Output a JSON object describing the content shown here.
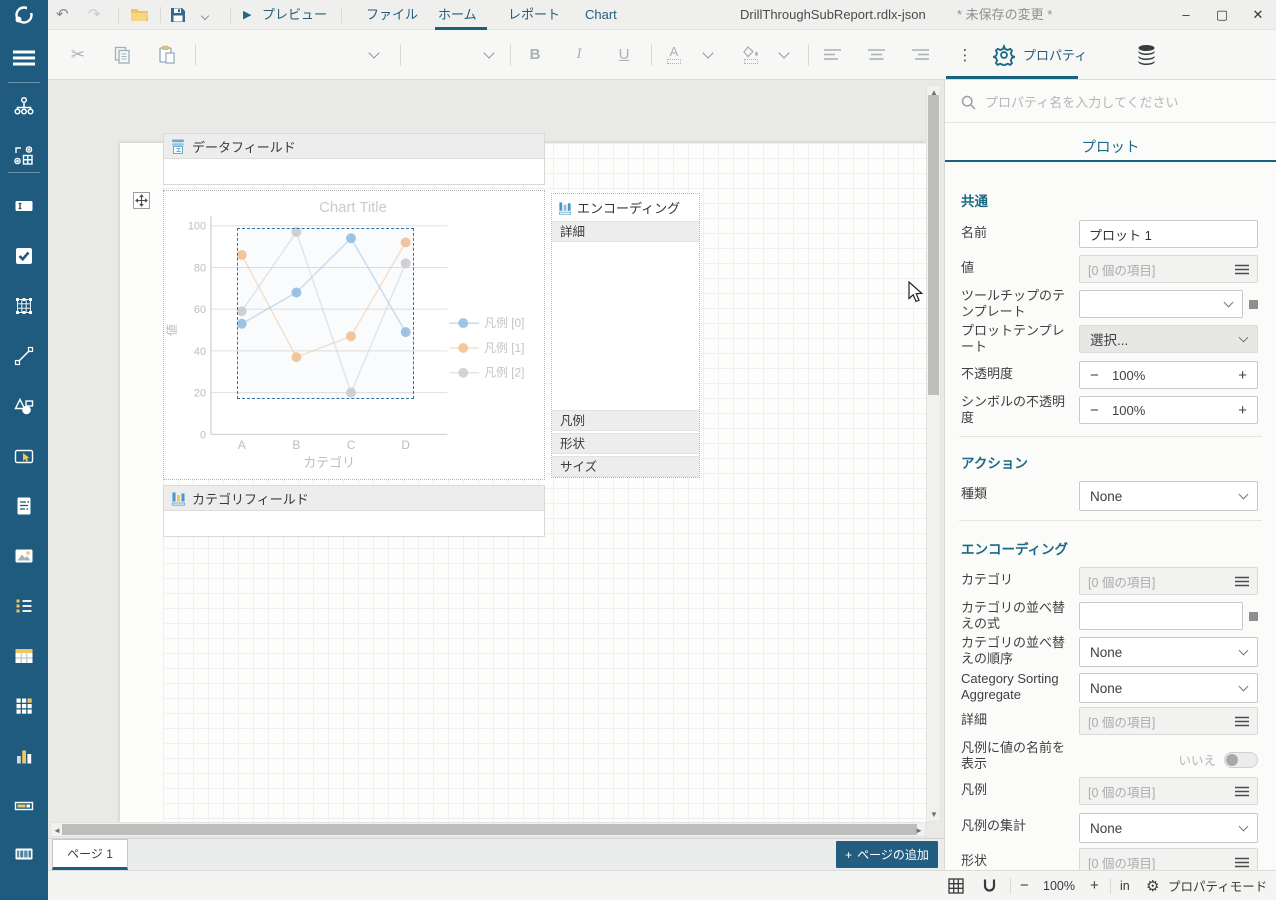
{
  "titlebar": {
    "preview_label": "プレビュー",
    "tabs": [
      {
        "label": "ファイル"
      },
      {
        "label": "ホーム"
      },
      {
        "label": "レポート"
      },
      {
        "label": "Chart"
      }
    ],
    "filename": "DrillThroughSubReport.rdlx-json",
    "unsaved_indicator": "* 未保存の変更 *"
  },
  "glyphs": {
    "minimize": "–",
    "maximize": "▢",
    "close": "✕",
    "undo": "↶",
    "redo": "↷",
    "play": "▶",
    "scissors": "✂",
    "dots_vertical": "⋮",
    "gear": "⚙",
    "minus": "−",
    "plus": "+",
    "arrow_up": "▲",
    "arrow_down": "▼",
    "arrow_left": "◄",
    "arrow_right": "►"
  },
  "toolbar": {
    "bold_label": "B",
    "italic_label": "I",
    "underline_label": "U",
    "font_color_label": "A",
    "properties_tab_label": "プロパティ"
  },
  "sidebar": {
    "items": [
      "org-chart",
      "layout-grid",
      "textbox",
      "checkbox",
      "grid-handles",
      "line",
      "shapes",
      "selection-box",
      "richtext",
      "image",
      "bullet-list",
      "table",
      "matrix",
      "bar-chart",
      "progress-bar",
      "barcode"
    ]
  },
  "canvas": {
    "data_field_label": "データフィールド",
    "category_field_label": "カテゴリフィールド",
    "encoding_panel": {
      "title": "エンコーディング",
      "detail_row": "詳細",
      "bottom_rows": [
        "凡例",
        "形状",
        "サイズ"
      ]
    },
    "page_tab": "ページ 1",
    "add_page_label": "ページの追加"
  },
  "chart_data": {
    "type": "line",
    "title": "Chart Title",
    "categories": [
      "A",
      "B",
      "C",
      "D"
    ],
    "series": [
      {
        "name": "凡例 [0]",
        "color": "#8fbcdf",
        "values": [
          53,
          68,
          94,
          49
        ]
      },
      {
        "name": "凡例 [1]",
        "color": "#f4c08c",
        "values": [
          86,
          37,
          47,
          92
        ]
      },
      {
        "name": "凡例 [2]",
        "color": "#cccccc",
        "values": [
          59,
          97,
          20,
          82
        ]
      }
    ],
    "xlabel": "カテゴリ",
    "ylabel": "値",
    "ylim": [
      0,
      100
    ],
    "yticks": [
      0,
      20,
      40,
      60,
      80,
      100
    ],
    "grid": true,
    "legend_position": "right"
  },
  "properties": {
    "search_placeholder": "プロパティ名を入力してください",
    "selection_title": "プロット",
    "sections": {
      "common": "共通",
      "action": "アクション",
      "encoding": "エンコーディング"
    },
    "rows": {
      "name": {
        "label": "名前",
        "value": "プロット 1"
      },
      "value": {
        "label": "値",
        "value": "[0 個の項目]"
      },
      "tooltip_template": {
        "label": "ツールチップのテンプレート",
        "value": ""
      },
      "plot_template": {
        "label": "プロットテンプレート",
        "value": "選択..."
      },
      "opacity": {
        "label": "不透明度",
        "value": "100%"
      },
      "symbol_opacity": {
        "label": "シンボルの不透明度",
        "value": "100%"
      },
      "action_type": {
        "label": "種類",
        "value": "None"
      },
      "category": {
        "label": "カテゴリ",
        "value": "[0 個の項目]"
      },
      "category_sort_expr": {
        "label": "カテゴリの並べ替えの式",
        "value": ""
      },
      "category_sort_order": {
        "label": "カテゴリの並べ替えの順序",
        "value": "None"
      },
      "category_sort_aggregate": {
        "label": "Category Sorting Aggregate",
        "value": "None"
      },
      "detail": {
        "label": "詳細",
        "value": "[0 個の項目]"
      },
      "show_value_names": {
        "label": "凡例に値の名前を表示",
        "value": "いいえ"
      },
      "legend": {
        "label": "凡例",
        "value": "[0 個の項目]"
      },
      "legend_aggregate": {
        "label": "凡例の集計",
        "value": "None"
      },
      "shape": {
        "label": "形状",
        "value": "[0 個の項目]"
      }
    }
  },
  "statusbar": {
    "zoom_value": "100%",
    "unit": "in",
    "mode_label": "プロパティモード"
  }
}
